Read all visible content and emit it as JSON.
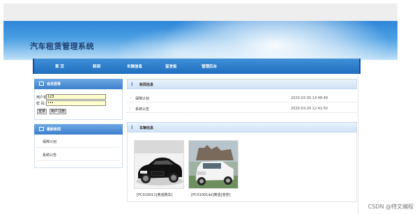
{
  "site": {
    "title": "汽车租赁管理系统"
  },
  "nav": {
    "items": [
      {
        "label": "首 页"
      },
      {
        "label": "新闻"
      },
      {
        "label": "车辆信息"
      },
      {
        "label": "留言板"
      },
      {
        "label": "管理后台"
      }
    ]
  },
  "login": {
    "header": "会员登录",
    "username_label": "用户名：",
    "username_value": "123",
    "password_label": "密   码：",
    "password_value": "•••",
    "login_button": "登录",
    "register_button": "用户注册"
  },
  "latest_news": {
    "header": "最新新闻",
    "items": [
      {
        "label": "保障计划"
      },
      {
        "label": "系统公告"
      }
    ]
  },
  "news_info": {
    "header": "新闻信息",
    "items": [
      {
        "title": "保障计划",
        "date": "2020-03-30 14:48:49"
      },
      {
        "title": "系统公告",
        "date": "2020-03-29 12:41:50"
      }
    ]
  },
  "vehicles": {
    "header": "车辆信息",
    "cards": [
      {
        "caption": "[PC010011]奥迪跑车]"
      },
      {
        "caption": "[PC01001dd]奥迪[普普]"
      }
    ]
  },
  "watermark": "CSDN @特文编程",
  "colors": {
    "nav_blue": "#1f6fc0",
    "panel_blue": "#3d7fcc",
    "title_navy": "#1f3f6e"
  }
}
